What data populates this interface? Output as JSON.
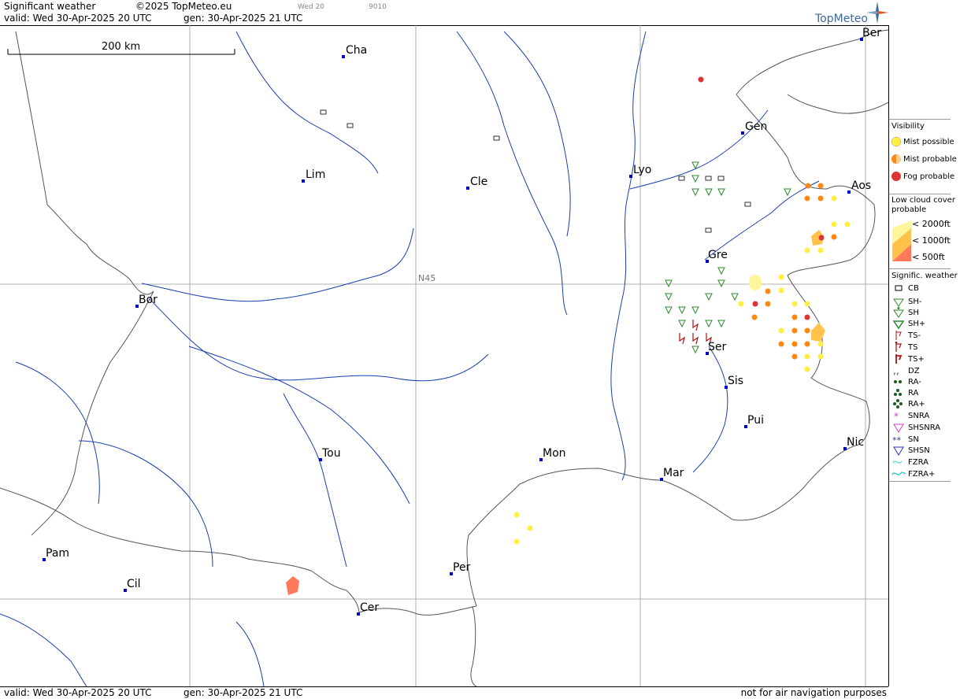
{
  "header": {
    "title": "Significant weather",
    "copyright": "©2025 TopMeteo.eu",
    "valid": "valid:  Wed  30-Apr-2025  20 UTC",
    "gen": "gen: 30-Apr-2025 21 UTC",
    "small_day": "Wed 20",
    "small_code": "9010",
    "brand": "TopMeteo"
  },
  "map": {
    "scale_label": "200 km",
    "grid_label": "N45",
    "cities": [
      {
        "name": "Cha"
      },
      {
        "name": "Lim"
      },
      {
        "name": "Cle"
      },
      {
        "name": "Lyo"
      },
      {
        "name": "Gen"
      },
      {
        "name": "Ber"
      },
      {
        "name": "Aos"
      },
      {
        "name": "Gre"
      },
      {
        "name": "Bor"
      },
      {
        "name": "Ser"
      },
      {
        "name": "Sis"
      },
      {
        "name": "Pui"
      },
      {
        "name": "Tou"
      },
      {
        "name": "Mon"
      },
      {
        "name": "Mar"
      },
      {
        "name": "Nic"
      },
      {
        "name": "Pam"
      },
      {
        "name": "Cil"
      },
      {
        "name": "Per"
      },
      {
        "name": "Cer"
      }
    ]
  },
  "footer": {
    "valid": "valid:  Wed  30-Apr-2025  20 UTC",
    "gen": "gen: 30-Apr-2025 21 UTC",
    "disclaimer": "not for air navigation purposes"
  },
  "legend": {
    "visibility_title": "Visibility",
    "visibility": [
      "Mist possible",
      "Mist probable",
      "Fog probable"
    ],
    "low_cloud_title": "Low cloud cover probable",
    "low_cloud": [
      "< 2000ft",
      "< 1000ft",
      "<   500ft"
    ],
    "sigwx_title": "Signific. weather",
    "sigwx": [
      "CB",
      "SH-",
      "SH",
      "SH+",
      "TS-",
      "TS",
      "TS+",
      "DZ",
      "RA-",
      "RA",
      "RA+",
      "SNRA",
      "SHSNRA",
      "SN",
      "SHSN",
      "FZRA",
      "FZRA+"
    ]
  },
  "colors": {
    "city_marker": "#0000cc",
    "river": "#1a3fb0",
    "border": "#555555",
    "grid": "#888888",
    "mist_possible": "#ffee44",
    "mist_probable": "#ff8811",
    "fog_probable": "#dd3333",
    "shower": "#2a8a2a",
    "thunder": "#aa1111",
    "rain": "#1a5a1a",
    "snow_rain": "#cc44cc",
    "snow": "#2233cc",
    "freezing": "#33cccc"
  }
}
